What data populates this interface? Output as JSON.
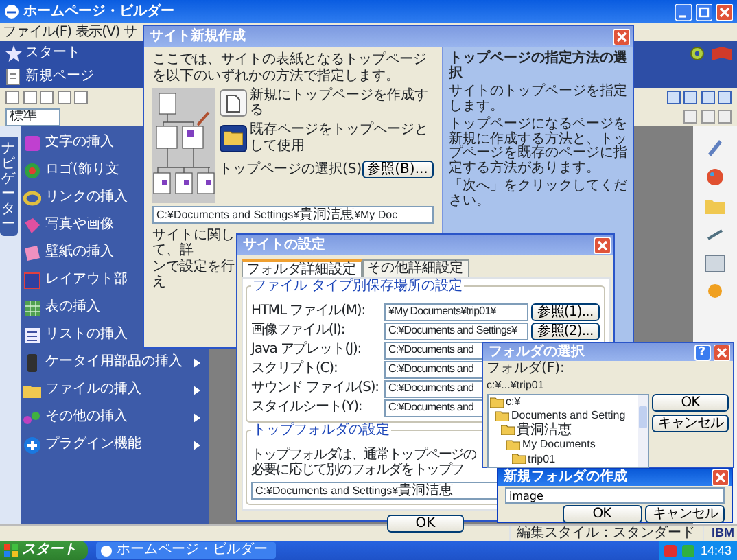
{
  "app": {
    "title": "ホームページ・ビルダー",
    "menu": [
      "ファイル(F)",
      "表示(V)",
      "サ"
    ],
    "tabs": [
      "スタート",
      "新規ページ"
    ],
    "style_select": "標準",
    "side_tab": "ナビゲーター",
    "sidebar": [
      {
        "label": "文字の挿入",
        "submenu": false
      },
      {
        "label": "ロゴ(飾り文",
        "submenu": false
      },
      {
        "label": "リンクの挿入",
        "submenu": false
      },
      {
        "label": "写真や画像",
        "submenu": false
      },
      {
        "label": "壁紙の挿入",
        "submenu": false
      },
      {
        "label": "レイアウト部",
        "submenu": false
      },
      {
        "label": "表の挿入",
        "submenu": false
      },
      {
        "label": "リストの挿入",
        "submenu": false
      },
      {
        "label": "ケータイ用部品の挿入",
        "submenu": true
      },
      {
        "label": "ファイルの挿入",
        "submenu": true
      },
      {
        "label": "その他の挿入",
        "submenu": true
      },
      {
        "label": "プラグイン機能",
        "submenu": true
      }
    ],
    "status": "編集スタイル：スタンダード",
    "brand": "IBM"
  },
  "wizard": {
    "title": "サイト新規作成",
    "intro": "ここでは、サイトの表紙となるトップページを以下のいずれかの方法で指定します。",
    "options": [
      {
        "label": "新規にトップページを作成する",
        "selected": false
      },
      {
        "label": "既存ページをトップページとして使用",
        "selected": true
      }
    ],
    "select_label": "トップページの選択(S)",
    "browse": "参照(B)...",
    "path": "C:¥Documents and Settings¥貴洞洁恵¥My Doc",
    "note": [
      "サイトに関して、詳",
      "ンで設定を行え"
    ],
    "help": {
      "title": "トップページの指定方法の選択",
      "paragraphs": [
        "サイトのトップページを指定します。",
        "トップページになるページを新規に作成する方法と、トップページを既存のページに指定する方法があります。",
        "「次へ」をクリックしてください。"
      ]
    }
  },
  "site_settings": {
    "title": "サイトの設定",
    "tabs": [
      {
        "label": "フォルダ詳細設定",
        "selected": true
      },
      {
        "label": "その他詳細設定",
        "selected": false
      }
    ],
    "file_group": "ファイル タイプ別保存場所の設定",
    "rows": [
      {
        "label": "HTML ファイル(M):",
        "value": "¥My Documents¥trip01¥",
        "button": "参照(1)..."
      },
      {
        "label": "画像ファイル(I):",
        "value": "C:¥Documents and Settings¥",
        "button": "参照(2)..."
      },
      {
        "label": "Java アプレット(J):",
        "value": "C:¥Documents and"
      },
      {
        "label": "スクリプト(C):",
        "value": "C:¥Documents and"
      },
      {
        "label": "サウンド ファイル(S):",
        "value": "C:¥Documents and"
      },
      {
        "label": "スタイルシート(Y):",
        "value": "C:¥Documents and"
      }
    ],
    "top_group": "トップフォルダの設定",
    "top_text": [
      "トップフォルダは、通常トップページの",
      "必要に応じて別のフォルダをトップフ"
    ],
    "top_path": "C:¥Documents and Settings¥貴洞洁恵",
    "ok": "OK"
  },
  "folder_dialog": {
    "title": "フォルダの選択",
    "help_button": "?",
    "folder_label": "フォルダ(F):",
    "path": "c:¥...¥trip01",
    "tree": [
      {
        "label": "c:¥",
        "children": [
          {
            "label": "Documents and Setting",
            "children": [
              {
                "label": "貴洞洁恵",
                "children": [
                  {
                    "label": "My Documents",
                    "children": [
                      {
                        "label": "trip01"
                      }
                    ]
                  }
                ]
              }
            ]
          }
        ]
      }
    ],
    "buttons": [
      "OK",
      "キャンセル"
    ]
  },
  "new_folder": {
    "title": "新規フォルダの作成",
    "value": "image",
    "buttons": [
      "OK",
      "キャンセル"
    ]
  },
  "taskbar": {
    "start": "スタート",
    "task": "ホームページ・ビルダー",
    "clock": "14:43"
  }
}
